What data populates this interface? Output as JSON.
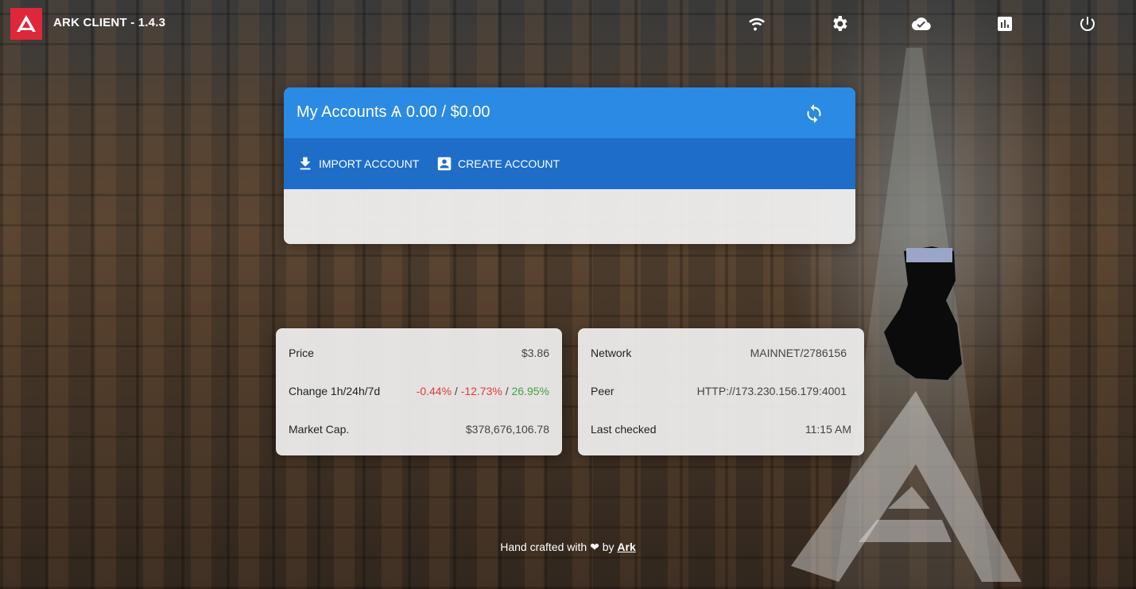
{
  "app": {
    "title": "ARK CLIENT - 1.4.3"
  },
  "topbar": {
    "icons": [
      "wifi-icon",
      "settings-icon",
      "cloud-check-icon",
      "chart-icon",
      "power-icon"
    ]
  },
  "accounts": {
    "title": "My Accounts Ѧ 0.00 / $0.00",
    "import_label": "IMPORT ACCOUNT",
    "create_label": "CREATE ACCOUNT"
  },
  "market": {
    "price_label": "Price",
    "price_value": "$3.86",
    "change_label": "Change 1h/24h/7d",
    "change_1h": "-0.44%",
    "change_24h": "-12.73%",
    "change_7d": "26.95%",
    "separator": "/",
    "marketcap_label": "Market Cap.",
    "marketcap_value": "$378,676,106.78"
  },
  "network": {
    "network_label": "Network",
    "network_value": "MAINNET/2786156",
    "peer_label": "Peer",
    "peer_value": "HTTP://173.230.156.179:4001",
    "checked_label": "Last checked",
    "checked_value": "11:15 AM"
  },
  "footer": {
    "prefix": "Hand crafted with",
    "by": "by",
    "link": "Ark"
  },
  "colors": {
    "brand_red": "#e0263a",
    "header_blue": "#2a8ae4",
    "actions_blue": "#1e6dc9",
    "negative": "#e53935",
    "positive": "#43a047"
  }
}
